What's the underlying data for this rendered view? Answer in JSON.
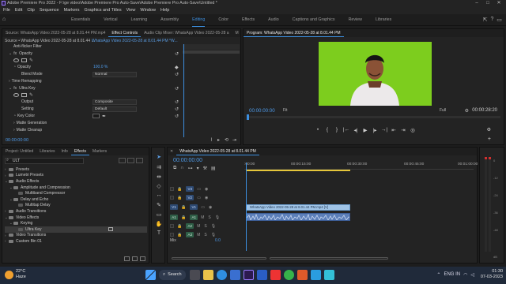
{
  "app": {
    "title": "Adobe Premiere Pro 2022 - F:\\ge video\\Adobe Premiere Pro Auto-Save\\Adobe Premiere Pro Auto-Save\\Untitled *",
    "window_controls": [
      "–",
      "□",
      "✕"
    ]
  },
  "menu": [
    "File",
    "Edit",
    "Clip",
    "Sequence",
    "Markers",
    "Graphics and Titles",
    "View",
    "Window",
    "Help"
  ],
  "workspaces": {
    "items": [
      "Essentials",
      "Vertical",
      "Learning",
      "Assembly",
      "Editing",
      "Color",
      "Effects",
      "Audio",
      "Captions and Graphics",
      "Review",
      "Libraries"
    ],
    "active": "Editing"
  },
  "effect_controls": {
    "tabs": [
      "Source: WhatsApp Video 2022-05-28 at 8.01.44 PM.mp4",
      "Effect Controls",
      "Audio Clip Mixer: WhatsApp Video 2022-05-28 a",
      "M"
    ],
    "active_tab": "Effect Controls",
    "source_line": "Source • WhatsApp Video 2022-05-28 at 8.01.44 ...",
    "sequence_line": "WhatsApp Video 2022-05-28 at 8.01.44 PM *W...",
    "rows": [
      {
        "label": "Anti-flicker Filter",
        "value": ""
      },
      {
        "label": "Opacity",
        "value": ""
      },
      {
        "label": "Opacity",
        "value": "100.0 %"
      },
      {
        "label": "Blend Mode",
        "value": "Normal"
      },
      {
        "label": "Time Remapping",
        "value": ""
      },
      {
        "label": "Ultra Key",
        "value": ""
      },
      {
        "label": "Output",
        "value": "Composite"
      },
      {
        "label": "Setting",
        "value": "Default"
      },
      {
        "label": "Key Color",
        "value": ""
      },
      {
        "label": "Matte Generation",
        "value": ""
      },
      {
        "label": "Matte Cleanup",
        "value": ""
      }
    ],
    "timecode": "00:00:00:00"
  },
  "program_monitor": {
    "title": "Program: WhatsApp Video 2022-05-28 at 8.01.44 PM",
    "timecode_current": "00:00:00:00",
    "fit": "Fit",
    "resolution": "Full",
    "timecode_duration": "00:00:28:20",
    "controls": [
      "•",
      "{",
      "}",
      "|←",
      "◂|",
      "▶",
      "|▸",
      "→|",
      "⇤",
      "⇥",
      "◎"
    ]
  },
  "project_panel": {
    "tabs": [
      "Project: Untitled",
      "Libraries",
      "Info",
      "Effects",
      "Markers"
    ],
    "active_tab": "Effects",
    "search_value": "ULT",
    "tree": [
      {
        "label": "Presets",
        "level": 0,
        "selected": false
      },
      {
        "label": "Lumetri Presets",
        "level": 0,
        "selected": false
      },
      {
        "label": "Audio Effects",
        "level": 0,
        "selected": false
      },
      {
        "label": "Amplitude and Compression",
        "level": 1,
        "selected": false
      },
      {
        "label": "Multiband Compressor",
        "level": 2,
        "selected": false
      },
      {
        "label": "Delay and Echo",
        "level": 1,
        "selected": false
      },
      {
        "label": "Multitap Delay",
        "level": 2,
        "selected": false
      },
      {
        "label": "Audio Transitions",
        "level": 0,
        "selected": false
      },
      {
        "label": "Video Effects",
        "level": 0,
        "selected": false
      },
      {
        "label": "Keying",
        "level": 1,
        "selected": false
      },
      {
        "label": "Ultra Key",
        "level": 2,
        "selected": true
      },
      {
        "label": "Video Transitions",
        "level": 0,
        "selected": false
      },
      {
        "label": "Custom Bin 01",
        "level": 0,
        "selected": false
      }
    ]
  },
  "timeline": {
    "tab": "WhatsApp Video 2022-05-28 at 8.01.44 PM",
    "timecode": "00:00:00:00",
    "ruler": [
      ":00:00",
      "00:00:15:00",
      "00:00:30:00",
      "00:00:45:00",
      "00:01:00:00"
    ],
    "tracks": [
      {
        "id": "V3",
        "type": "video"
      },
      {
        "id": "V2",
        "type": "video"
      },
      {
        "id": "V1",
        "type": "video"
      },
      {
        "id": "A1",
        "type": "audio"
      },
      {
        "id": "A2",
        "type": "audio"
      },
      {
        "id": "A3",
        "type": "audio"
      }
    ],
    "video_clip": "WhatsApp Video 2022-05-28 at 8.01.44 PM.mp4 [V]",
    "mix_label": "Mix",
    "mix_value": "0.0"
  },
  "meters": {
    "labels": [
      "0",
      "-12",
      "-24",
      "-36",
      "-48",
      "dB"
    ]
  },
  "taskbar": {
    "weather_temp": "22°C",
    "weather_desc": "Haze",
    "search_label": "Search",
    "time": "01:30",
    "date": "07-03-2023",
    "lang": "ENG IN",
    "colors": {
      "accent": "#3c8fe0",
      "green_screen": "#7dcd1e"
    }
  }
}
